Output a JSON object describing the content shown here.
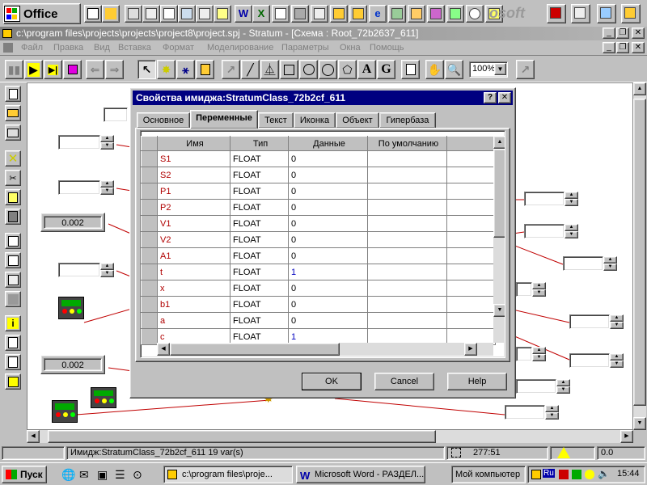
{
  "office_bar": {
    "logo_text": "Office",
    "faint_text": "osoft"
  },
  "window": {
    "title": "c:\\program files\\projects\\projects\\project8\\project.spj - Stratum - [Схема : Root_72b2637_611]",
    "minimize": "_",
    "restore": "❐",
    "close": "✕"
  },
  "menu": [
    "Файл",
    "Правка",
    "Вид",
    "Вставка",
    "Формат",
    "Моделирование",
    "Параметры",
    "Окна",
    "Помощь"
  ],
  "toolbar": {
    "zoom": "100%"
  },
  "canvas": {
    "value_boxes": [
      "0.002",
      "0.002"
    ]
  },
  "dialog": {
    "title": "Свойства имиджа:StratumClass_72b2cf_611",
    "help_btn": "?",
    "close_btn": "✕",
    "tabs": [
      "Основное",
      "Переменные",
      "Текст",
      "Иконка",
      "Объект",
      "Гипербаза"
    ],
    "active_tab": "Переменные",
    "columns": [
      "Имя",
      "Тип",
      "Данные",
      "По умолчанию"
    ],
    "rows": [
      {
        "name": "S1",
        "type": "FLOAT",
        "data": "0",
        "blue": false
      },
      {
        "name": "S2",
        "type": "FLOAT",
        "data": "0",
        "blue": false
      },
      {
        "name": "P1",
        "type": "FLOAT",
        "data": "0",
        "blue": false
      },
      {
        "name": "P2",
        "type": "FLOAT",
        "data": "0",
        "blue": false
      },
      {
        "name": "V1",
        "type": "FLOAT",
        "data": "0",
        "blue": false
      },
      {
        "name": "V2",
        "type": "FLOAT",
        "data": "0",
        "blue": false
      },
      {
        "name": "A1",
        "type": "FLOAT",
        "data": "0",
        "blue": false
      },
      {
        "name": "t",
        "type": "FLOAT",
        "data": "1",
        "blue": true
      },
      {
        "name": "x",
        "type": "FLOAT",
        "data": "0",
        "blue": false
      },
      {
        "name": "b1",
        "type": "FLOAT",
        "data": "0",
        "blue": false
      },
      {
        "name": "a",
        "type": "FLOAT",
        "data": "0",
        "blue": false
      },
      {
        "name": "c",
        "type": "FLOAT",
        "data": "1",
        "blue": true
      }
    ],
    "ok": "OK",
    "cancel": "Cancel",
    "help": "Help"
  },
  "status": {
    "text": "Имидж:StratumClass_72b2cf_611 19 var(s)",
    "coords": "277:51",
    "value": "0.0"
  },
  "taskbar": {
    "start": "Пуск",
    "tasks": [
      "c:\\program files\\proje...",
      "Microsoft Word - РАЗДЕЛ..."
    ],
    "computer": "Мой компьютер",
    "lang": "Ru",
    "clock": "15:44"
  }
}
